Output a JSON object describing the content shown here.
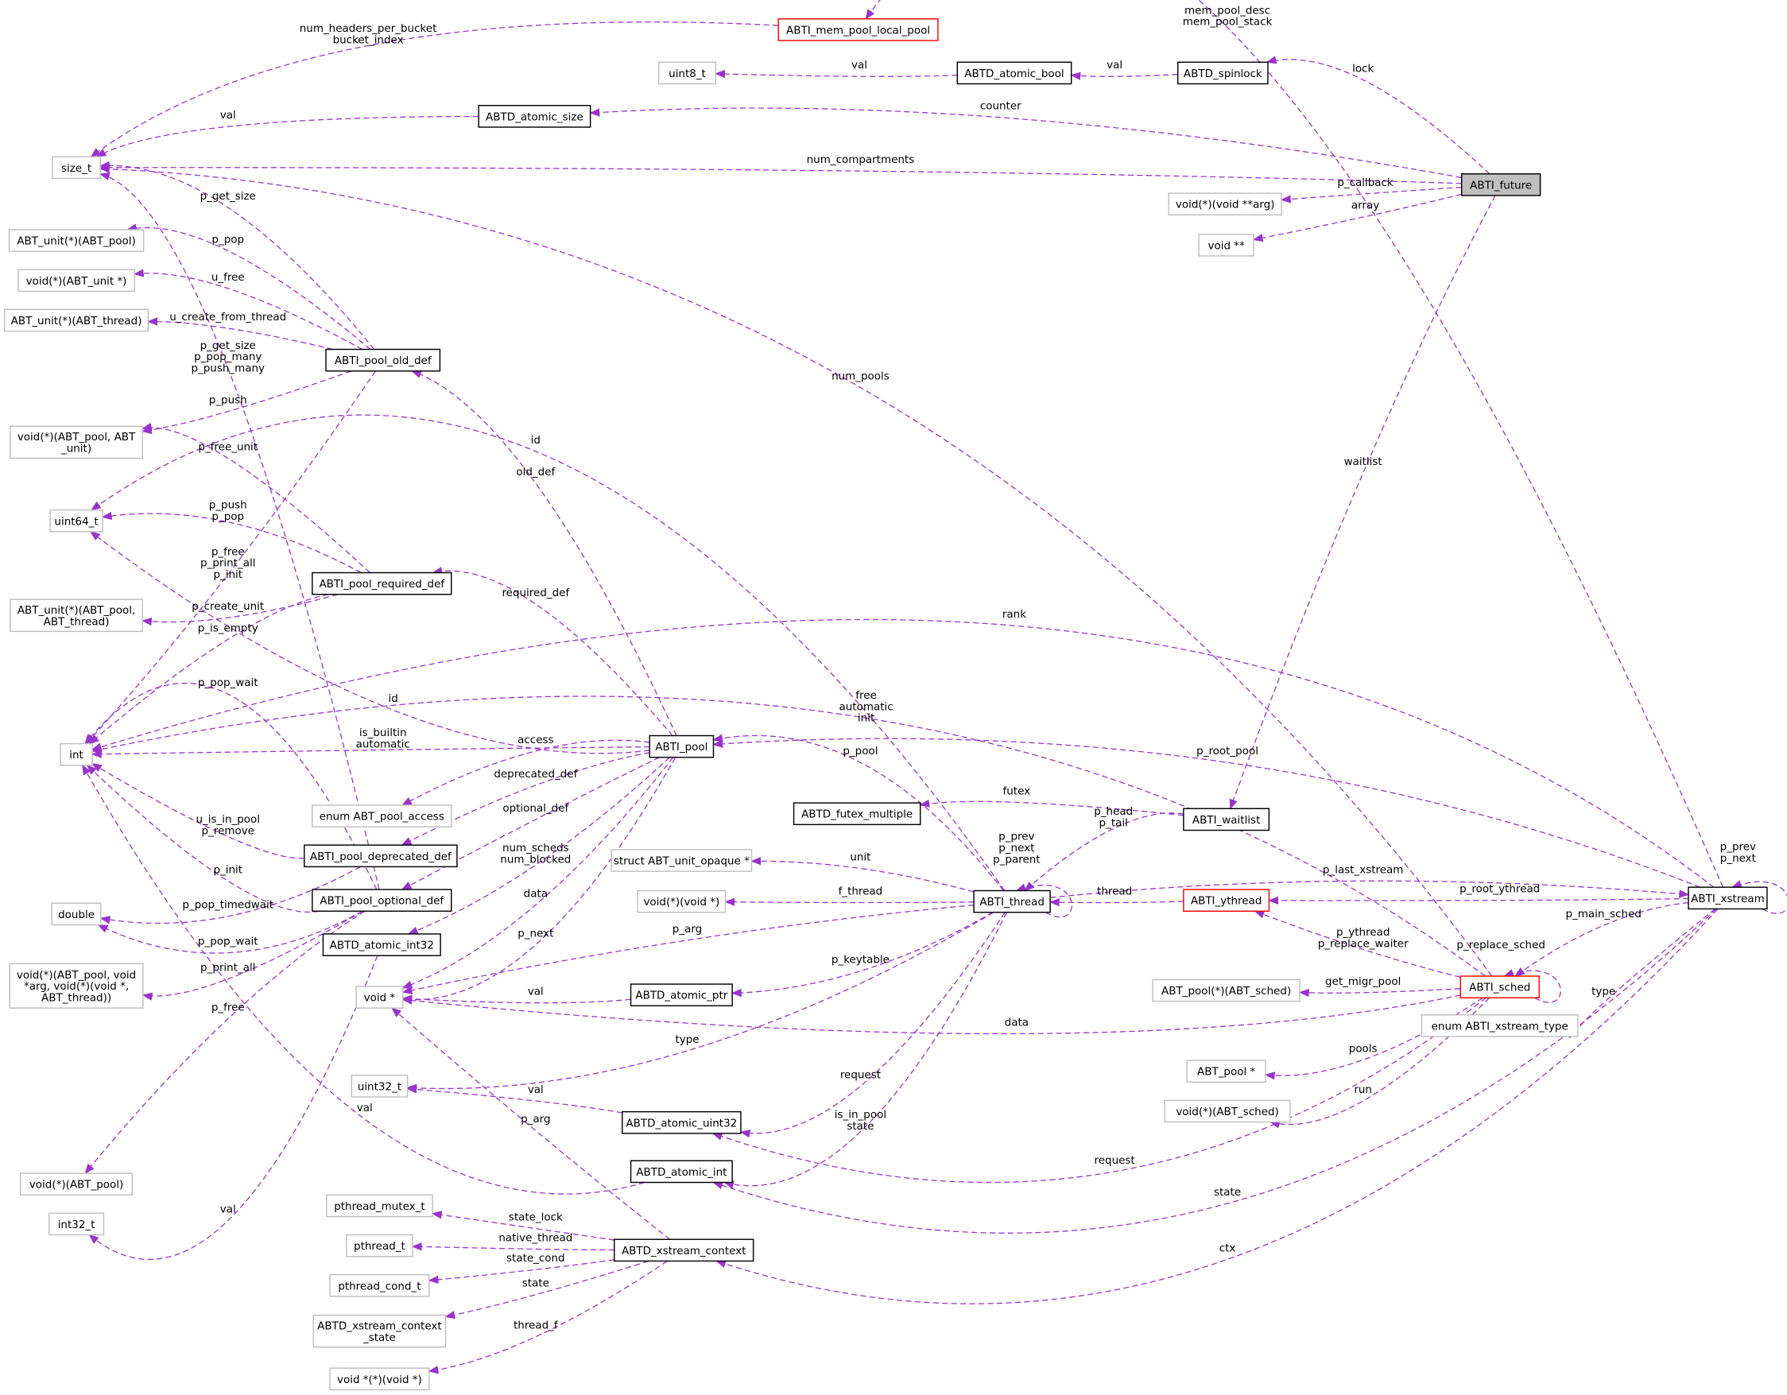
{
  "diagram": {
    "type": "collaboration-graph",
    "edge_color": "#9a32cd",
    "node_styles": {
      "normal": {
        "border": "#000000",
        "fill": "#ffffff"
      },
      "external": {
        "border": "#bfbfbf",
        "fill": "#ffffff"
      },
      "truncated": {
        "border": "#ff0000",
        "fill": "#ffffff"
      },
      "focus": {
        "border": "#000000",
        "fill": "#bfbfbf"
      }
    }
  },
  "nodes": [
    {
      "id": "mem_pool_local_pool",
      "label": [
        "ABTI_mem_pool_local_pool"
      ],
      "style": "truncated"
    },
    {
      "id": "uint8_t",
      "label": [
        "uint8_t"
      ],
      "style": "external"
    },
    {
      "id": "atomic_bool",
      "label": [
        "ABTD_atomic_bool"
      ],
      "style": "normal"
    },
    {
      "id": "spinlock",
      "label": [
        "ABTD_spinlock"
      ],
      "style": "normal"
    },
    {
      "id": "atomic_size",
      "label": [
        "ABTD_atomic_size"
      ],
      "style": "normal"
    },
    {
      "id": "size_t",
      "label": [
        "size_t"
      ],
      "style": "external"
    },
    {
      "id": "future",
      "label": [
        "ABTI_future"
      ],
      "style": "focus"
    },
    {
      "id": "cb_fn",
      "label": [
        "void(*)(void **arg)"
      ],
      "style": "external"
    },
    {
      "id": "voidpp",
      "label": [
        "void **"
      ],
      "style": "external"
    },
    {
      "id": "unit_pool_fn",
      "label": [
        "ABT_unit(*)(ABT_pool)"
      ],
      "style": "external"
    },
    {
      "id": "void_unit_fn",
      "label": [
        "void(*)(ABT_unit *)"
      ],
      "style": "external"
    },
    {
      "id": "unit_thread_fn",
      "label": [
        "ABT_unit(*)(ABT_thread)"
      ],
      "style": "external"
    },
    {
      "id": "pool_old_def",
      "label": [
        "ABTI_pool_old_def"
      ],
      "style": "normal"
    },
    {
      "id": "void_pool_unit_fn",
      "label": [
        "void(*)(ABT_pool, ABT",
        "_unit)"
      ],
      "style": "external"
    },
    {
      "id": "uint64_t",
      "label": [
        "uint64_t"
      ],
      "style": "external"
    },
    {
      "id": "pool_required_def",
      "label": [
        "ABTI_pool_required_def"
      ],
      "style": "normal"
    },
    {
      "id": "unit_pool_thread_fn",
      "label": [
        "ABT_unit(*)(ABT_pool,",
        "ABT_thread)"
      ],
      "style": "external"
    },
    {
      "id": "int",
      "label": [
        "int"
      ],
      "style": "external"
    },
    {
      "id": "pool",
      "label": [
        "ABTI_pool"
      ],
      "style": "normal"
    },
    {
      "id": "pool_access",
      "label": [
        "enum ABT_pool_access"
      ],
      "style": "external"
    },
    {
      "id": "pool_deprecated_def",
      "label": [
        "ABTI_pool_deprecated_def"
      ],
      "style": "normal"
    },
    {
      "id": "futex_multiple",
      "label": [
        "ABTD_futex_multiple"
      ],
      "style": "normal"
    },
    {
      "id": "waitlist",
      "label": [
        "ABTI_waitlist"
      ],
      "style": "normal"
    },
    {
      "id": "unit_opaque",
      "label": [
        "struct ABT_unit_opaque *"
      ],
      "style": "external"
    },
    {
      "id": "double",
      "label": [
        "double"
      ],
      "style": "external"
    },
    {
      "id": "pool_optional_def",
      "label": [
        "ABTI_pool_optional_def"
      ],
      "style": "normal"
    },
    {
      "id": "thread",
      "label": [
        "ABTI_thread"
      ],
      "style": "normal"
    },
    {
      "id": "ythread",
      "label": [
        "ABTI_ythread"
      ],
      "style": "truncated"
    },
    {
      "id": "xstream",
      "label": [
        "ABTI_xstream"
      ],
      "style": "normal"
    },
    {
      "id": "void_void_fn",
      "label": [
        "void(*)(void *)"
      ],
      "style": "external"
    },
    {
      "id": "atomic_int32",
      "label": [
        "ABTD_atomic_int32"
      ],
      "style": "normal"
    },
    {
      "id": "print_all_fn",
      "label": [
        "void(*)(ABT_pool, void",
        "*arg, void(*)(void *,",
        "ABT_thread))"
      ],
      "style": "external"
    },
    {
      "id": "voidp",
      "label": [
        "void *"
      ],
      "style": "external"
    },
    {
      "id": "atomic_ptr",
      "label": [
        "ABTD_atomic_ptr"
      ],
      "style": "normal"
    },
    {
      "id": "migr_pool_fn",
      "label": [
        "ABT_pool(*)(ABT_sched)"
      ],
      "style": "external"
    },
    {
      "id": "sched",
      "label": [
        "ABTI_sched"
      ],
      "style": "truncated"
    },
    {
      "id": "xstream_type",
      "label": [
        "enum ABTI_xstream_type"
      ],
      "style": "external"
    },
    {
      "id": "pool_ptr",
      "label": [
        "ABT_pool *"
      ],
      "style": "external"
    },
    {
      "id": "uint32_t",
      "label": [
        "uint32_t"
      ],
      "style": "external"
    },
    {
      "id": "atomic_uint32",
      "label": [
        "ABTD_atomic_uint32"
      ],
      "style": "normal"
    },
    {
      "id": "sched_fn",
      "label": [
        "void(*)(ABT_sched)"
      ],
      "style": "external"
    },
    {
      "id": "void_pool_fn",
      "label": [
        "void(*)(ABT_pool)"
      ],
      "style": "external"
    },
    {
      "id": "atomic_int",
      "label": [
        "ABTD_atomic_int"
      ],
      "style": "normal"
    },
    {
      "id": "int32_t",
      "label": [
        "int32_t"
      ],
      "style": "external"
    },
    {
      "id": "pthread_mutex_t",
      "label": [
        "pthread_mutex_t"
      ],
      "style": "external"
    },
    {
      "id": "pthread_t",
      "label": [
        "pthread_t"
      ],
      "style": "external"
    },
    {
      "id": "xstream_context",
      "label": [
        "ABTD_xstream_context"
      ],
      "style": "normal"
    },
    {
      "id": "pthread_cond_t",
      "label": [
        "pthread_cond_t"
      ],
      "style": "external"
    },
    {
      "id": "xstream_context_state",
      "label": [
        "ABTD_xstream_context",
        "_state"
      ],
      "style": "external"
    },
    {
      "id": "thread_f_fn",
      "label": [
        "void *(*)(void *)"
      ],
      "style": "external"
    }
  ],
  "edges": [
    {
      "from": "xstream",
      "to": "mem_pool_local_pool",
      "label": [
        "mem_pool_desc",
        "mem_pool_stack"
      ]
    },
    {
      "from": "mem_pool_local_pool",
      "to": "size_t",
      "label": [
        "num_headers_per_bucket",
        "bucket_index"
      ]
    },
    {
      "from": "atomic_bool",
      "to": "uint8_t",
      "label": [
        "val"
      ]
    },
    {
      "from": "spinlock",
      "to": "atomic_bool",
      "label": [
        "val"
      ]
    },
    {
      "from": "future",
      "to": "spinlock",
      "label": [
        "lock"
      ]
    },
    {
      "from": "future",
      "to": "atomic_size",
      "label": [
        "counter"
      ]
    },
    {
      "from": "atomic_size",
      "to": "size_t",
      "label": [
        "val"
      ]
    },
    {
      "from": "future",
      "to": "size_t",
      "label": [
        "num_compartments"
      ]
    },
    {
      "from": "future",
      "to": "cb_fn",
      "label": [
        "p_callback"
      ]
    },
    {
      "from": "future",
      "to": "voidpp",
      "label": [
        "array"
      ]
    },
    {
      "from": "future",
      "to": "waitlist",
      "label": [
        "waitlist"
      ]
    },
    {
      "from": "pool_old_def",
      "to": "size_t",
      "label": [
        "p_get_size"
      ]
    },
    {
      "from": "pool_old_def",
      "to": "unit_pool_fn",
      "label": [
        "p_pop"
      ]
    },
    {
      "from": "pool_old_def",
      "to": "void_unit_fn",
      "label": [
        "u_free"
      ]
    },
    {
      "from": "pool_old_def",
      "to": "unit_thread_fn",
      "label": [
        "u_create_from_thread"
      ]
    },
    {
      "from": "pool_optional_def",
      "to": "size_t",
      "label": [
        "p_get_size",
        "p_pop_many",
        "p_push_many"
      ]
    },
    {
      "from": "pool_old_def",
      "to": "void_pool_unit_fn",
      "label": [
        "p_push"
      ]
    },
    {
      "from": "pool_required_def",
      "to": "void_pool_unit_fn",
      "label": [
        "p_free_unit"
      ]
    },
    {
      "from": "thread",
      "to": "uint64_t",
      "label": [
        "id"
      ]
    },
    {
      "from": "pool",
      "to": "pool_old_def",
      "label": [
        "old_def"
      ]
    },
    {
      "from": "pool_required_def",
      "to": "uint64_t",
      "label": [
        "p_push",
        "p_pop"
      ]
    },
    {
      "from": "pool_old_def",
      "to": "int",
      "label": [
        "p_free",
        "p_print_all",
        "p_init"
      ]
    },
    {
      "from": "pool_required_def",
      "to": "unit_pool_thread_fn",
      "label": [
        "p_create_unit"
      ]
    },
    {
      "from": "pool",
      "to": "pool_required_def",
      "label": [
        "required_def"
      ]
    },
    {
      "from": "pool_required_def",
      "to": "int",
      "label": [
        "p_is_empty"
      ]
    },
    {
      "from": "xstream",
      "to": "int",
      "label": [
        "rank"
      ]
    },
    {
      "from": "pool_optional_def",
      "to": "int",
      "label": [
        "p_pop_wait"
      ]
    },
    {
      "from": "pool",
      "to": "uint64_t",
      "label": [
        "id"
      ]
    },
    {
      "from": "sched",
      "to": "int",
      "label": [
        "free",
        "automatic",
        "init"
      ]
    },
    {
      "from": "pool",
      "to": "int",
      "label": [
        "is_builtin",
        "automatic"
      ]
    },
    {
      "from": "pool",
      "to": "pool_access",
      "label": [
        "access"
      ]
    },
    {
      "from": "pool",
      "to": "pool_deprecated_def",
      "label": [
        "deprecated_def"
      ]
    },
    {
      "from": "pool",
      "to": "pool_optional_def",
      "label": [
        "optional_def"
      ]
    },
    {
      "from": "thread",
      "to": "pool",
      "label": [
        "p_pool"
      ]
    },
    {
      "from": "xstream",
      "to": "pool",
      "label": [
        "p_root_pool"
      ]
    },
    {
      "from": "waitlist",
      "to": "futex_multiple",
      "label": [
        "futex"
      ]
    },
    {
      "from": "waitlist",
      "to": "thread",
      "label": [
        "p_head",
        "p_tail"
      ]
    },
    {
      "from": "pool_deprecated_def",
      "to": "int",
      "label": [
        "u_is_in_pool",
        "p_remove"
      ]
    },
    {
      "from": "pool_optional_def",
      "to": "int",
      "label": [
        "p_init"
      ]
    },
    {
      "from": "thread",
      "to": "thread",
      "label": [
        "p_prev",
        "p_next",
        "p_parent"
      ]
    },
    {
      "from": "xstream",
      "to": "xstream",
      "label": [
        "p_prev",
        "p_next"
      ]
    },
    {
      "from": "thread",
      "to": "unit_opaque",
      "label": [
        "unit"
      ]
    },
    {
      "from": "thread",
      "to": "xstream",
      "label": [
        "p_last_xstream"
      ]
    },
    {
      "from": "ythread",
      "to": "thread",
      "label": [
        "thread"
      ]
    },
    {
      "from": "xstream",
      "to": "ythread",
      "label": [
        "p_root_ythread"
      ]
    },
    {
      "from": "thread",
      "to": "void_void_fn",
      "label": [
        "f_thread"
      ]
    },
    {
      "from": "pool_deprecated_def",
      "to": "double",
      "label": [
        "p_pop_timedwait"
      ]
    },
    {
      "from": "pool",
      "to": "atomic_int32",
      "label": [
        "num_scheds",
        "num_blocked"
      ]
    },
    {
      "from": "pool",
      "to": "voidp",
      "label": [
        "data"
      ]
    },
    {
      "from": "xstream",
      "to": "sched",
      "label": [
        "p_main_sched"
      ]
    },
    {
      "from": "sched",
      "to": "ythread",
      "label": [
        "p_ythread",
        "p_replace_waiter"
      ]
    },
    {
      "from": "sched",
      "to": "sched",
      "label": [
        "p_replace_sched"
      ]
    },
    {
      "from": "pool_optional_def",
      "to": "double",
      "label": [
        "p_pop_wait"
      ]
    },
    {
      "from": "pool",
      "to": "voidp",
      "label": [
        "p_next"
      ]
    },
    {
      "from": "thread",
      "to": "voidp",
      "label": [
        "p_arg"
      ]
    },
    {
      "from": "pool_optional_def",
      "to": "print_all_fn",
      "label": [
        "p_print_all"
      ]
    },
    {
      "from": "thread",
      "to": "atomic_ptr",
      "label": [
        "p_keytable"
      ]
    },
    {
      "from": "atomic_ptr",
      "to": "voidp",
      "label": [
        "val"
      ]
    },
    {
      "from": "sched",
      "to": "migr_pool_fn",
      "label": [
        "get_migr_pool"
      ]
    },
    {
      "from": "xstream",
      "to": "xstream_type",
      "label": [
        "type"
      ]
    },
    {
      "from": "pool_optional_def",
      "to": "void_pool_fn",
      "label": [
        "p_free"
      ]
    },
    {
      "from": "sched",
      "to": "voidp",
      "label": [
        "data"
      ]
    },
    {
      "from": "thread",
      "to": "uint32_t",
      "label": [
        "type"
      ]
    },
    {
      "from": "sched",
      "to": "pool_ptr",
      "label": [
        "pools"
      ]
    },
    {
      "from": "thread",
      "to": "atomic_uint32",
      "label": [
        "request"
      ]
    },
    {
      "from": "atomic_uint32",
      "to": "uint32_t",
      "label": [
        "val"
      ]
    },
    {
      "from": "sched",
      "to": "sched_fn",
      "label": [
        "run"
      ]
    },
    {
      "from": "thread",
      "to": "atomic_int",
      "label": [
        "is_in_pool",
        "state"
      ]
    },
    {
      "from": "atomic_int",
      "to": "int",
      "label": [
        "val"
      ]
    },
    {
      "from": "sched",
      "to": "atomic_uint32",
      "label": [
        "request"
      ]
    },
    {
      "from": "xstream",
      "to": "atomic_int",
      "label": [
        "state"
      ]
    },
    {
      "from": "atomic_int32",
      "to": "int32_t",
      "label": [
        "val"
      ]
    },
    {
      "from": "xstream_context",
      "to": "voidp",
      "label": [
        "p_arg"
      ]
    },
    {
      "from": "xstream",
      "to": "xstream_context",
      "label": [
        "ctx"
      ]
    },
    {
      "from": "xstream_context",
      "to": "pthread_mutex_t",
      "label": [
        "state_lock"
      ]
    },
    {
      "from": "xstream_context",
      "to": "pthread_t",
      "label": [
        "native_thread"
      ]
    },
    {
      "from": "xstream_context",
      "to": "pthread_cond_t",
      "label": [
        "state_cond"
      ]
    },
    {
      "from": "xstream_context",
      "to": "xstream_context_state",
      "label": [
        "state"
      ]
    },
    {
      "from": "xstream_context",
      "to": "thread_f_fn",
      "label": [
        "thread_f"
      ]
    },
    {
      "from": "sched",
      "to": "size_t",
      "label": [
        "num_pools"
      ]
    }
  ]
}
